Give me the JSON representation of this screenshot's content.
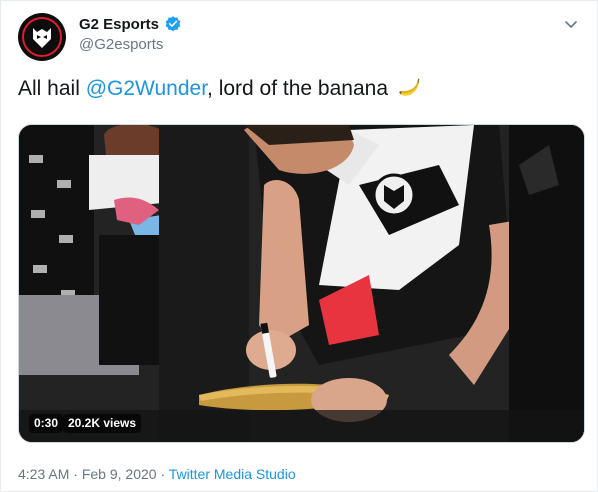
{
  "account": {
    "display_name": "G2 Esports",
    "handle": "@G2esports",
    "verified": true,
    "avatar_icon": "g2-logo-icon"
  },
  "tweet": {
    "text_before": "All hail ",
    "mention": "@G2Wunder",
    "text_after": ", lord of the banana",
    "emoji": "banana-icon"
  },
  "media": {
    "duration": "0:30",
    "views": "20.2K views"
  },
  "meta": {
    "time": "4:23 AM",
    "separator1": " · ",
    "date": "Feb 9, 2020",
    "separator2": " · ",
    "source": "Twitter Media Studio"
  },
  "colors": {
    "link": "#1b95e0",
    "secondary": "#657786",
    "verified": "#1da1f2",
    "brand_red": "#e21b2f"
  }
}
